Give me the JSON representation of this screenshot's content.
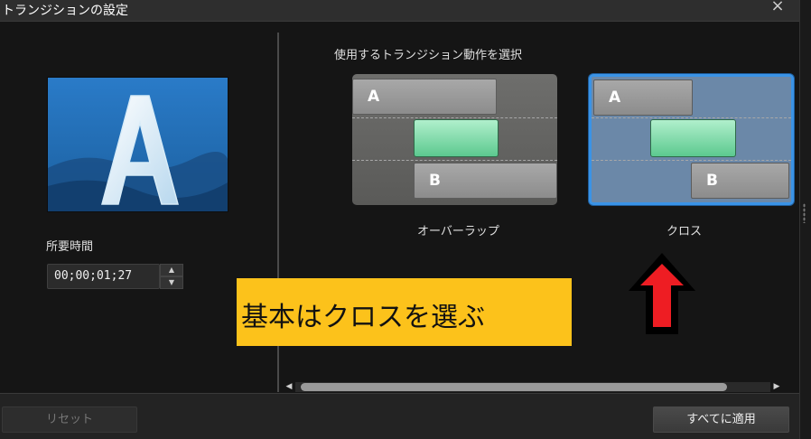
{
  "window": {
    "title": "トランジションの設定",
    "close_glyph": "×"
  },
  "left_panel": {
    "preview_letter": "A",
    "duration_label": "所要時間",
    "duration_value": "00;00;01;27",
    "spin_up_glyph": "▲",
    "spin_down_glyph": "▼"
  },
  "right_panel": {
    "section_label": "使用するトランジション動作を選択",
    "options": [
      {
        "caption": "オーバーラップ",
        "track_a_label": "A",
        "track_b_label": "B",
        "selected": false
      },
      {
        "caption": "クロス",
        "track_a_label": "A",
        "track_b_label": "B",
        "selected": true
      }
    ]
  },
  "annotation": {
    "callout_text": "基本はクロスを選ぶ",
    "callout_color": "#fcc21b",
    "arrow_color": "#ee1d23"
  },
  "scrollbar": {
    "left_glyph": "◀",
    "right_glyph": "▶"
  },
  "footer": {
    "reset_label": "リセット",
    "apply_all_label": "すべてに適用"
  },
  "colors": {
    "selection_border": "#3a93e6",
    "green_clip": "#5cc98f"
  }
}
